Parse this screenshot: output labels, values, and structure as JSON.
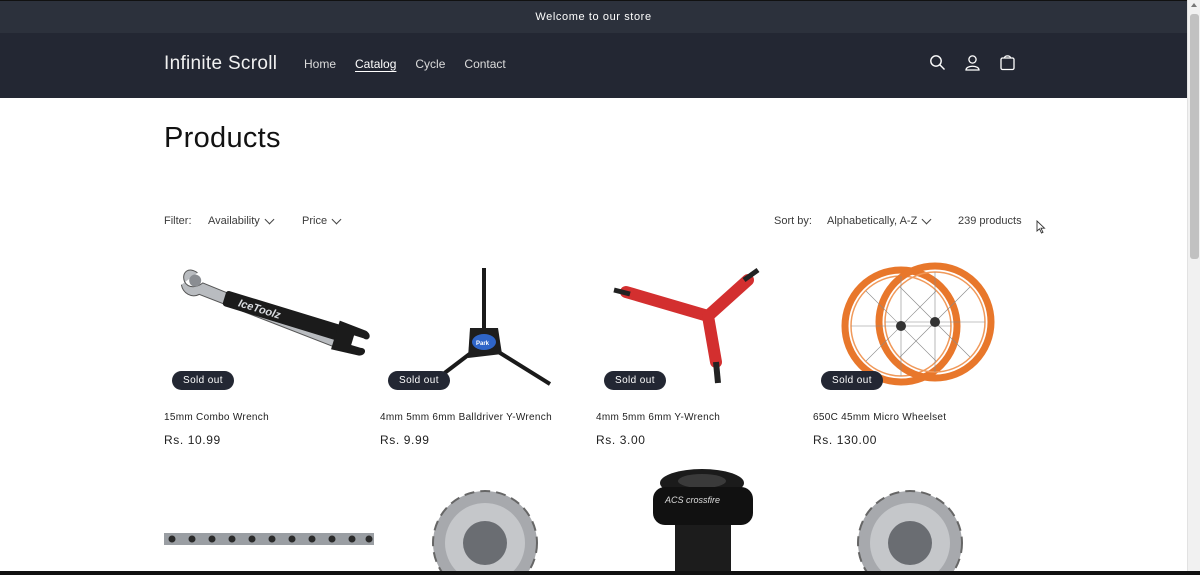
{
  "announcement": {
    "text": "Welcome to our store"
  },
  "header": {
    "logo": "Infinite Scroll",
    "nav": [
      {
        "label": "Home",
        "active": false
      },
      {
        "label": "Catalog",
        "active": true
      },
      {
        "label": "Cycle",
        "active": false
      },
      {
        "label": "Contact",
        "active": false
      }
    ],
    "icons": [
      "search-icon",
      "account-icon",
      "cart-icon"
    ]
  },
  "page": {
    "title": "Products"
  },
  "filters": {
    "filter_label": "Filter:",
    "availability": "Availability",
    "price": "Price",
    "sort_label": "Sort by:",
    "sort_value": "Alphabetically, A-Z",
    "count": "239 products"
  },
  "products": [
    {
      "name": "15mm Combo Wrench",
      "price": "Rs. 10.99",
      "badge": "Sold out"
    },
    {
      "name": "4mm 5mm 6mm Balldriver Y-Wrench",
      "price": "Rs. 9.99",
      "badge": "Sold out"
    },
    {
      "name": "4mm 5mm 6mm Y-Wrench",
      "price": "Rs. 3.00",
      "badge": "Sold out"
    },
    {
      "name": "650C 45mm Micro Wheelset",
      "price": "Rs. 130.00",
      "badge": "Sold out"
    }
  ],
  "colors": {
    "header_bg": "#232733",
    "announcement_bg": "#2c313c",
    "badge_bg": "#232733",
    "wheel_orange": "#e8772b",
    "ywrench_red": "#d32f2f"
  }
}
